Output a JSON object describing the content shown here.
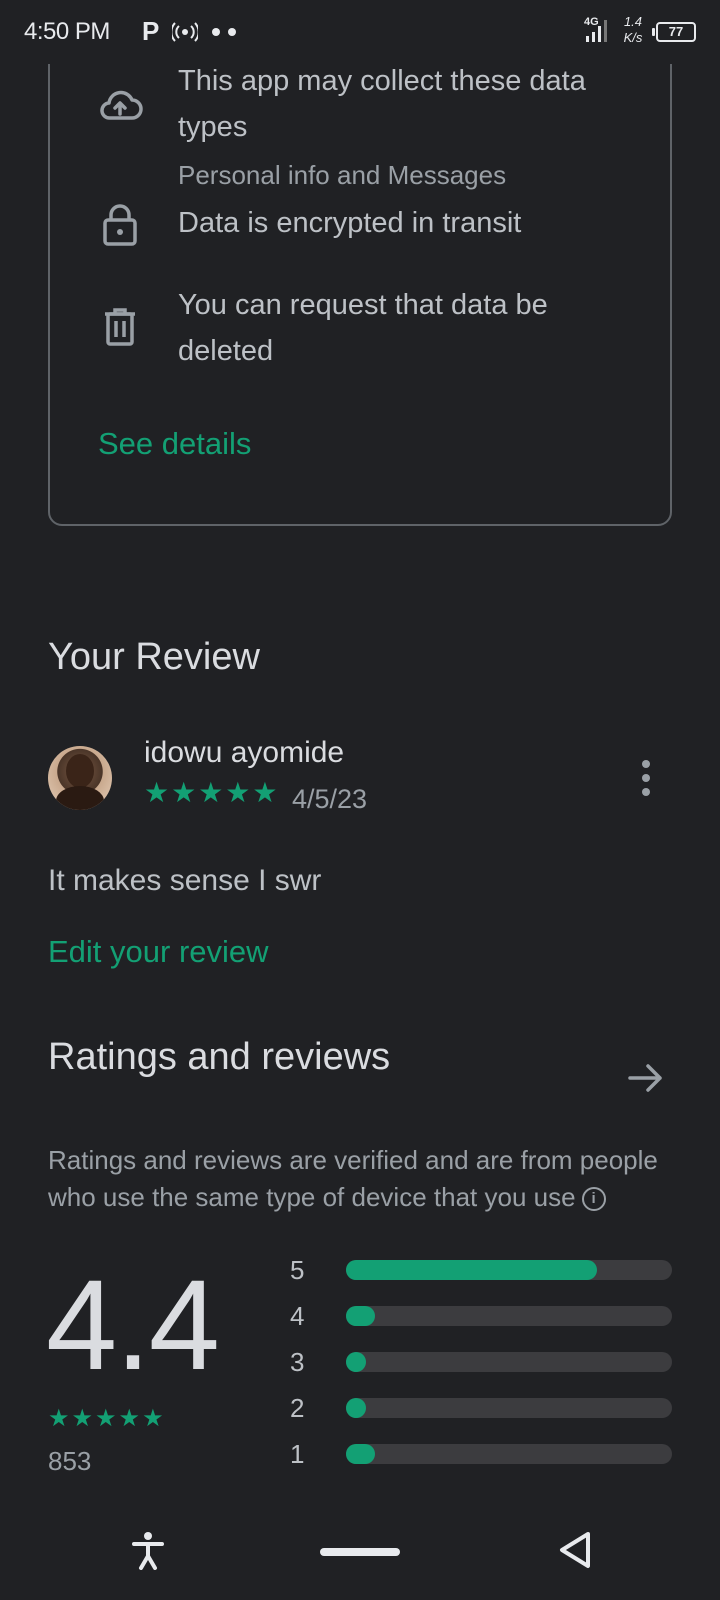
{
  "status_bar": {
    "time": "4:50 PM",
    "carrier_icon": "P",
    "network_type": "4G",
    "speed_value": "1.4",
    "speed_unit": "K/s",
    "battery": "77"
  },
  "data_safety": {
    "items": [
      {
        "icon": "cloud-upload-icon",
        "title": "This app may collect these data types",
        "subtitle": "Personal info and Messages"
      },
      {
        "icon": "lock-icon",
        "title": "Data is encrypted in transit"
      },
      {
        "icon": "trash-icon",
        "title": "You can request that data be deleted"
      }
    ],
    "see_details": "See details"
  },
  "your_review": {
    "title": "Your Review",
    "reviewer_name": "idowu ayomide",
    "stars": "★★★★★",
    "date": "4/5/23",
    "text": "It makes sense I swr",
    "edit_label": "Edit your review"
  },
  "ratings": {
    "title": "Ratings and reviews",
    "description": "Ratings and reviews are verified and are from people who use the same type of device that you use",
    "average": "4.4",
    "stars_display": "★★★★★",
    "total": "853",
    "distribution": [
      {
        "label": "5",
        "fraction": 0.77
      },
      {
        "label": "4",
        "fraction": 0.09
      },
      {
        "label": "3",
        "fraction": 0.06
      },
      {
        "label": "2",
        "fraction": 0.06
      },
      {
        "label": "1",
        "fraction": 0.09
      }
    ]
  },
  "colors": {
    "accent": "#13a074",
    "background": "#202124"
  }
}
